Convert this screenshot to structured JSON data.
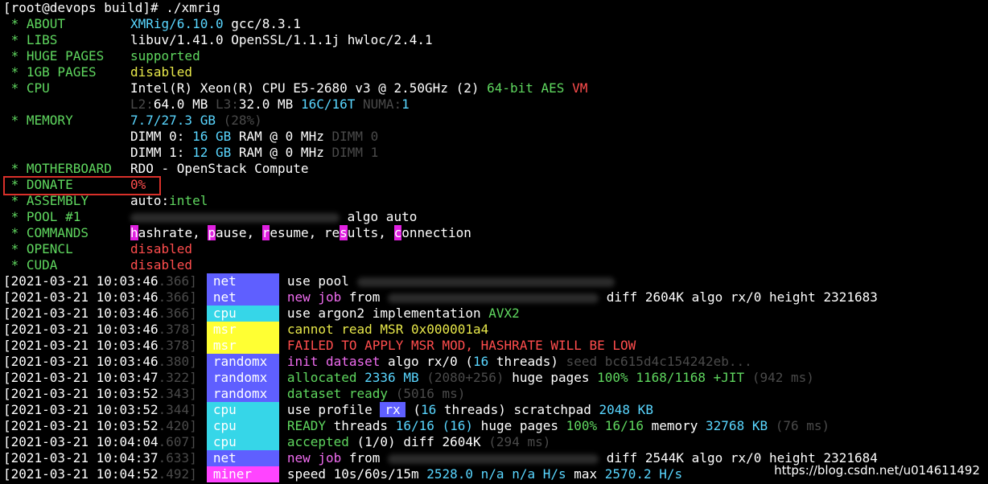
{
  "prompt": "[root@devops build]# ./xmrig",
  "info": {
    "about_label": " * ABOUT",
    "about_val": "XMRig/6.10.0",
    "about_gcc": " gcc/8.3.1",
    "libs_label": " * LIBS",
    "libs_val": "libuv/1.41.0 OpenSSL/1.1.1j hwloc/2.4.1",
    "huge_label": " * HUGE PAGES",
    "huge_val": "supported",
    "gb1_label": " * 1GB PAGES",
    "gb1_val": "disabled",
    "cpu_label": " * CPU",
    "cpu_val": "Intel(R) Xeon(R) CPU E5-2680 v3 @ 2.50GHz (2) ",
    "cpu_flags": "64-bit AES",
    "cpu_vm": " VM",
    "cache_l2k": "L2:",
    "cache_l2v": "64.0 MB",
    "cache_l3k": " L3:",
    "cache_l3v": "32.0 MB",
    "cache_c": " 16C",
    "cache_t": "/16T",
    "cache_numak": " NUMA:",
    "cache_numav": "1",
    "mem_label": " * MEMORY",
    "mem_val": "7.7/27.3 GB",
    "mem_pct": " (28%)",
    "dimm0_a": "DIMM 0: ",
    "dimm0_b": "16 GB",
    "dimm0_c": " RAM @ 0 MHz ",
    "dimm0_d": "DIMM 0",
    "dimm1_a": "DIMM 1: ",
    "dimm1_b": "12 GB",
    "dimm1_c": " RAM @ 0 MHz ",
    "dimm1_d": "DIMM 1",
    "mb_label": " * MOTHERBOARD",
    "mb_val": "RDO - OpenStack Compute",
    "donate_label": " * DONATE",
    "donate_val": "0%",
    "asm_label": " * ASSEMBLY",
    "asm_a": "auto:",
    "asm_b": "intel",
    "pool_label": " * POOL #1",
    "pool_val": "algo auto",
    "cmd_label": " * COMMANDS",
    "opencl_label": " * OPENCL",
    "opencl_val": "disabled",
    "cuda_label": " * CUDA",
    "cuda_val": "disabled"
  },
  "commands": [
    {
      "key": "h",
      "rest": "ashrate, "
    },
    {
      "key": "p",
      "rest": "ause, "
    },
    {
      "key": "r",
      "rest": "esume, "
    },
    {
      "key": "re",
      "pre": "",
      "rest": ""
    },
    {
      "key": "c",
      "rest": "onnection"
    }
  ],
  "logs": [
    {
      "date": "[2021-03-21 10:03:46",
      "ms": ".366]",
      "tag": "net"
    },
    {
      "date": "[2021-03-21 10:03:46",
      "ms": ".366]",
      "tag": "net"
    },
    {
      "date": "[2021-03-21 10:03:46",
      "ms": ".366]",
      "tag": "cpu"
    },
    {
      "date": "[2021-03-21 10:03:46",
      "ms": ".378]",
      "tag": "msr"
    },
    {
      "date": "[2021-03-21 10:03:46",
      "ms": ".378]",
      "tag": "msr"
    },
    {
      "date": "[2021-03-21 10:03:46",
      "ms": ".380]",
      "tag": "randomx"
    },
    {
      "date": "[2021-03-21 10:03:47",
      "ms": ".322]",
      "tag": "randomx"
    },
    {
      "date": "[2021-03-21 10:03:52",
      "ms": ".343]",
      "tag": "randomx"
    },
    {
      "date": "[2021-03-21 10:03:52",
      "ms": ".344]",
      "tag": "cpu"
    },
    {
      "date": "[2021-03-21 10:03:52",
      "ms": ".420]",
      "tag": "cpu"
    },
    {
      "date": "[2021-03-21 10:04:04",
      "ms": ".607]",
      "tag": "cpu"
    },
    {
      "date": "[2021-03-21 10:04:37",
      "ms": ".633]",
      "tag": "net"
    },
    {
      "date": "[2021-03-21 10:04:52",
      "ms": ".492]",
      "tag": "miner"
    }
  ],
  "msgs": {
    "m0": "use pool",
    "m1a": "new job",
    "m1b": " from",
    "m1c": "diff 2604K algo rx/0 height 2321683",
    "m2a": "use argon2 implementation ",
    "m2b": "AVX2",
    "m3a": "cannot read MSR 0x000001a4",
    "m4a": "FAILED TO APPLY MSR MOD, HASHRATE WILL BE LOW",
    "m5a": "init dataset",
    "m5b": " algo rx/0 (",
    "m5c": "16",
    "m5d": " threads) ",
    "m5e": "seed bc615d4c154242eb...",
    "m6a": "allocated ",
    "m6b": "2336 MB",
    "m6c": " (2080+256)",
    "m6d": " huge pages ",
    "m6e": "100% 1168/1168",
    "m6f": " +JIT",
    "m6g": " (942 ms)",
    "m7a": "dataset ready",
    "m7b": " (5016 ms)",
    "m8a": "use profile ",
    "m8b": "rx",
    "m8c": " (",
    "m8d": "16",
    "m8e": " threads) scratchpad ",
    "m8f": "2048 KB",
    "m9a": "READY",
    "m9b": " threads ",
    "m9c": "16/16",
    "m9d": " (16)",
    "m9e": " huge pages ",
    "m9f": "100% 16/16",
    "m9g": " memory ",
    "m9h": "32768 KB",
    "m9i": " (76 ms)",
    "m10a": "accepted",
    "m10b": " (1/0) diff 2604K",
    "m10c": " (294 ms)",
    "m11a": "new job",
    "m11b": " from",
    "m11c": "diff 2544K algo rx/0 height 2321684",
    "m12a": "speed",
    "m12b": " 10s/60s/15m ",
    "m12c": "2528.0",
    "m12d": " n/a n/a H/s",
    "m12e": " max ",
    "m12f": "2570.2 H/s"
  },
  "watermark": "https://blog.csdn.net/u014611492"
}
